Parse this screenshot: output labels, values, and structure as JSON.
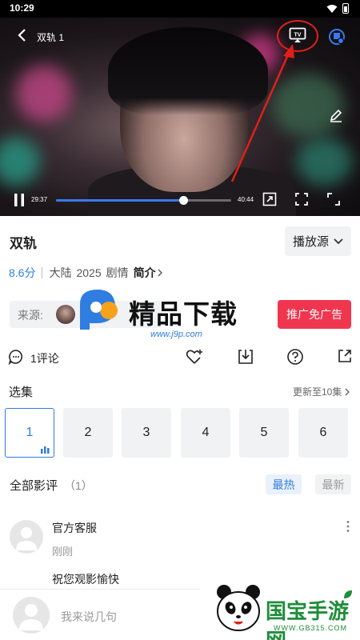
{
  "status_bar": {
    "time": "10:29"
  },
  "player": {
    "title": "双轨 1",
    "current_time": "29:37",
    "total_time": "40:44",
    "progress_fraction": 0.727,
    "cast_label": "TV"
  },
  "show": {
    "title": "双轨",
    "source_button": "播放源",
    "rating": "8.6分",
    "region": "大陆",
    "year": "2025",
    "genre": "剧情",
    "intro_link": "简介"
  },
  "source": {
    "label": "来源:",
    "promo_button": "推广免广告"
  },
  "watermark": {
    "text": "精品下载",
    "url": "www.j9p.com"
  },
  "actions": {
    "comment_count": "1评论"
  },
  "episodes": {
    "title": "选集",
    "update_text": "更新至10集",
    "items": [
      "1",
      "2",
      "3",
      "4",
      "5",
      "6"
    ],
    "active_index": 0
  },
  "reviews": {
    "title": "全部影评",
    "count": "（1）",
    "sort_hot": "最热",
    "sort_new": "最新",
    "items": [
      {
        "name": "官方客服",
        "time": "刚刚",
        "text": "祝您观影愉快"
      }
    ]
  },
  "composer": {
    "placeholder": "我来说几句"
  },
  "watermark2": {
    "text": "国宝手游网",
    "url": "WWW.GB315.COM"
  },
  "colors": {
    "accent": "#2f7de1",
    "promo": "#f0364f",
    "annotation": "#e0201a"
  },
  "icons": [
    "back-icon",
    "tv-cast-icon",
    "profile-icon",
    "edit-icon",
    "pause-icon",
    "pip-icon",
    "crop-icon",
    "fullscreen-icon",
    "chevron-down-icon",
    "comment-icon",
    "heart-plus-icon",
    "download-icon",
    "help-icon",
    "share-icon",
    "more-icon"
  ]
}
